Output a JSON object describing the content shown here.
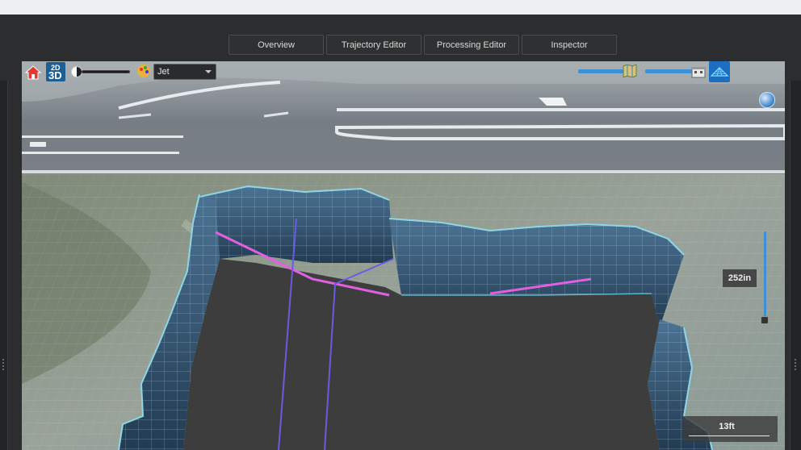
{
  "tabs": [
    {
      "label": "Overview"
    },
    {
      "label": "Trajectory Editor"
    },
    {
      "label": "Processing Editor"
    },
    {
      "label": "Inspector"
    }
  ],
  "toolbar": {
    "mode_top": "2D",
    "mode_bottom": "3D",
    "colormap": "Jet",
    "brightness": 0.05,
    "left_slider_level": 0.95,
    "right_slider_level": 0.95
  },
  "viewport": {
    "zoom_label": "252in",
    "scale_label": "13ft"
  },
  "colors": {
    "accent": "#3d8fd6",
    "wall": "#3b5f7c",
    "trench_floor": "#3d3d3d",
    "pipe_magenta": "#e060e0",
    "pipe_blue": "#6a5ce0"
  },
  "icons": [
    "home-icon",
    "mode-2d-3d-icon",
    "brightness-icon",
    "palette-icon",
    "map-icon",
    "building-icon",
    "grid-icon",
    "globe-icon"
  ]
}
